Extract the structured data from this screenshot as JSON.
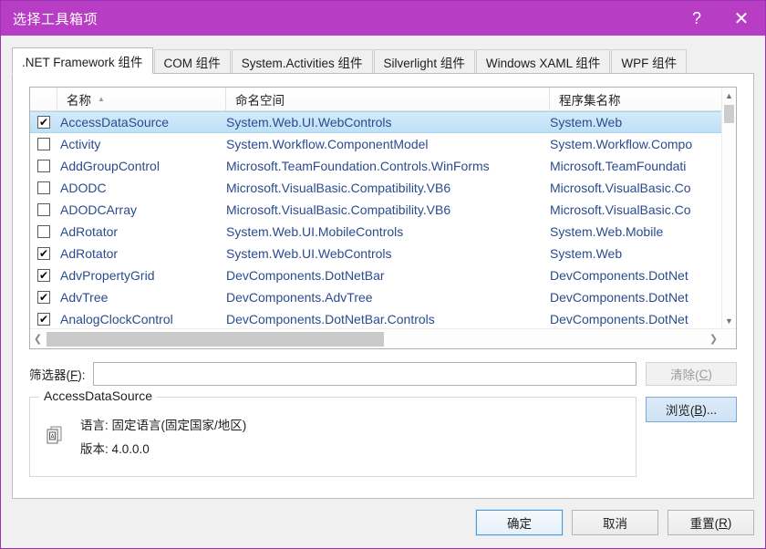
{
  "window": {
    "title": "选择工具箱项",
    "help_icon": "question-mark-icon",
    "help_label": "?",
    "close_label": "✕",
    "accent_color": "#b63dc4"
  },
  "tabs": [
    {
      "label": ".NET Framework 组件",
      "active": true
    },
    {
      "label": "COM 组件",
      "active": false
    },
    {
      "label": "System.Activities 组件",
      "active": false
    },
    {
      "label": "Silverlight 组件",
      "active": false
    },
    {
      "label": "Windows XAML 组件",
      "active": false
    },
    {
      "label": "WPF 组件",
      "active": false
    }
  ],
  "list": {
    "columns": [
      "",
      "名称",
      "命名空间",
      "程序集名称"
    ],
    "sort_column": "名称",
    "sort_direction": "ascending",
    "sort_glyph": "▲",
    "rows": [
      {
        "checked": true,
        "name": "AccessDataSource",
        "namespace": "System.Web.UI.WebControls",
        "assembly": "System.Web",
        "selected": true
      },
      {
        "checked": false,
        "name": "Activity",
        "namespace": "System.Workflow.ComponentModel",
        "assembly": "System.Workflow.Compo",
        "selected": false
      },
      {
        "checked": false,
        "name": "AddGroupControl",
        "namespace": "Microsoft.TeamFoundation.Controls.WinForms",
        "assembly": "Microsoft.TeamFoundati",
        "selected": false
      },
      {
        "checked": false,
        "name": "ADODC",
        "namespace": "Microsoft.VisualBasic.Compatibility.VB6",
        "assembly": "Microsoft.VisualBasic.Co",
        "selected": false
      },
      {
        "checked": false,
        "name": "ADODCArray",
        "namespace": "Microsoft.VisualBasic.Compatibility.VB6",
        "assembly": "Microsoft.VisualBasic.Co",
        "selected": false
      },
      {
        "checked": false,
        "name": "AdRotator",
        "namespace": "System.Web.UI.MobileControls",
        "assembly": "System.Web.Mobile",
        "selected": false
      },
      {
        "checked": true,
        "name": "AdRotator",
        "namespace": "System.Web.UI.WebControls",
        "assembly": "System.Web",
        "selected": false
      },
      {
        "checked": true,
        "name": "AdvPropertyGrid",
        "namespace": "DevComponents.DotNetBar",
        "assembly": "DevComponents.DotNet",
        "selected": false
      },
      {
        "checked": true,
        "name": "AdvTree",
        "namespace": "DevComponents.AdvTree",
        "assembly": "DevComponents.DotNet",
        "selected": false
      },
      {
        "checked": true,
        "name": "AnalogClockControl",
        "namespace": "DevComponents.DotNetBar.Controls",
        "assembly": "DevComponents.DotNet",
        "selected": false
      }
    ],
    "checked_glyph": "✔"
  },
  "scrollbars": {
    "v_up": "▲",
    "v_down": "▼",
    "h_left": "❮",
    "h_right": "❯"
  },
  "filter": {
    "label_prefix": "筛选器(",
    "label_key": "F",
    "label_suffix": "):",
    "value": "",
    "placeholder": ""
  },
  "clear_button": {
    "text_prefix": "清除(",
    "text_key": "C",
    "text_suffix": ")",
    "disabled": true
  },
  "browse_button": {
    "text_prefix": "浏览(",
    "text_key": "B",
    "text_suffix": ")..."
  },
  "info": {
    "legend": "AccessDataSource",
    "icon": "assembly-icon",
    "language_line": "语言: 固定语言(固定国家/地区)",
    "version_line": "版本: 4.0.0.0"
  },
  "footer": {
    "ok": "确定",
    "cancel": "取消",
    "reset_prefix": "重置(",
    "reset_key": "R",
    "reset_suffix": ")"
  }
}
